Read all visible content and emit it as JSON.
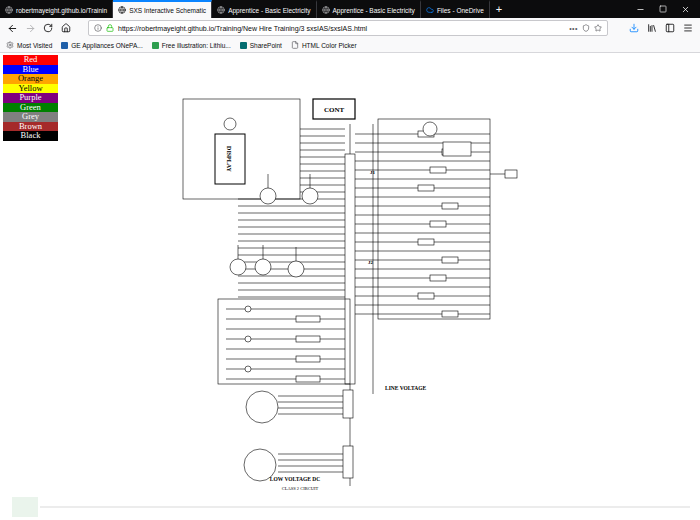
{
  "browser": {
    "tabs": [
      {
        "label": "robertmayeight.github.io/Trainin",
        "selected": false
      },
      {
        "label": "SXS Interactive Schematic",
        "selected": true
      },
      {
        "label": "Apprentice - Basic Electricity",
        "selected": false
      },
      {
        "label": "Apprentice - Basic Electricity",
        "selected": false
      },
      {
        "label": "Files - OneDrive",
        "selected": false
      }
    ],
    "new_tab": "+",
    "url": "https://robertmayeight.github.io/Training/New Hire Training/3 sxsIAS/sxsIAS.html",
    "page_actions": "•••",
    "bookmarks": [
      "Most Visited",
      "GE Appliances ONePA...",
      "Free illustration: Lithiu...",
      "SharePoint",
      "HTML Color Picker"
    ]
  },
  "legend": [
    {
      "label": "Red",
      "color": "#ff0000"
    },
    {
      "label": "Blue",
      "color": "#0000ff"
    },
    {
      "label": "Orange",
      "color": "#ffa500"
    },
    {
      "label": "Yellow",
      "color": "#ffff00"
    },
    {
      "label": "Purple",
      "color": "#800080"
    },
    {
      "label": "Green",
      "color": "#008000"
    },
    {
      "label": "Grey",
      "color": "#808080"
    },
    {
      "label": "Brown",
      "color": "#a52a2a"
    },
    {
      "label": "Black",
      "color": "#000000"
    }
  ],
  "schematic": {
    "labels": [
      "CONT",
      "DISPLAY",
      "J1",
      "J2",
      "LINE VOLTAGE",
      "LOW VOLTAGE DC",
      "CLASS 2 CIRCUIT"
    ]
  }
}
